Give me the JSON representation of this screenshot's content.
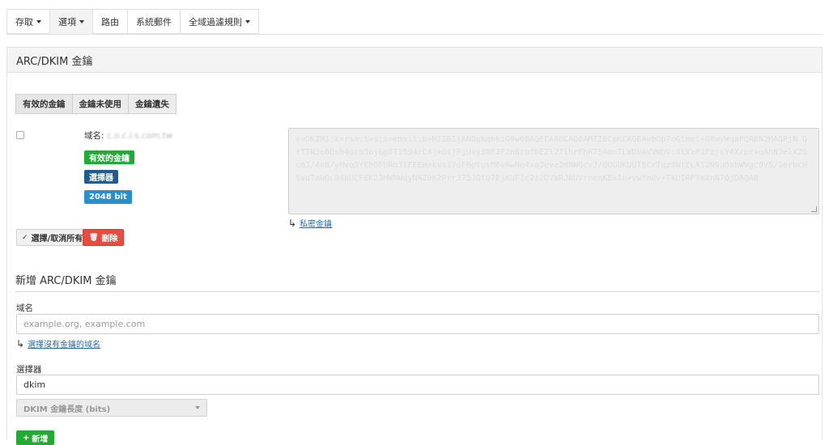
{
  "nav": {
    "tabs": [
      {
        "label": "存取",
        "dropdown": true
      },
      {
        "label": "選項",
        "dropdown": true,
        "active": true
      },
      {
        "label": "路由",
        "dropdown": false
      },
      {
        "label": "系統郵件",
        "dropdown": false
      },
      {
        "label": "全域過濾規則",
        "dropdown": true
      }
    ]
  },
  "panel": {
    "title": "ARC/DKIM 金鑰"
  },
  "key_tabs": [
    "有效的金鑰",
    "金鑰未使用",
    "金鑰遺失"
  ],
  "key": {
    "domain_label": "域名:",
    "domain_value": "c.o.c.l.s.com.tw",
    "status_badge": "有效的金鑰",
    "selector_badge": "選擇器 ",
    "bits_badge": "2048 bit",
    "public_key": "v=DKIM1;k=rsa;t=s;s=email;p=MIIBIjANBgkqhkiG9w0BAQEFAAOCAQ8AMIIBCgKCAQEAvbOp7oGlnel+8RwyWqaPQRBN2MAQPjN QYTTN3o6Osh4ocm5ojGg8T1594rC4j+GsjPjUxy3NFJF2n8cbfbEZl27lhrFhRT5AmnTLWDVAVVWbVc4lXxP1FzjsY4Xrpr+uAhNJelX2GcdJ/4n8/yHvq3YEbOFURqJIFEEWakvs17oF6pVusM6vAwNo4xqJeve2dNWOcvJ/QOGUKUUT5CrTqz8WfELA12N9uOsbWVgc9V5/1erbcHtvq7aUQc94pUCFEK23HWNWdyNAZ0K2PrrJ75JQtU7EjKUF1c2i2DVWRJNUVrnenKEx1n+vwfm0v+TkUIRPYmXnN7QjDAQAB",
    "private_key_link": "私密金鑰"
  },
  "actions": {
    "select_all": "選擇/取消所有",
    "delete": "刪除"
  },
  "add_form": {
    "title": "新增 ARC/DKIM 金鑰",
    "domain_label": "域名",
    "domain_placeholder": "example.org, example.com",
    "domain_link": "選擇沒有金鑰的域名",
    "selector_label": "選擇器",
    "selector_value": "dkim",
    "key_length_label": "DKIM 金鑰長度 (bits)",
    "add_button": "新增"
  }
}
